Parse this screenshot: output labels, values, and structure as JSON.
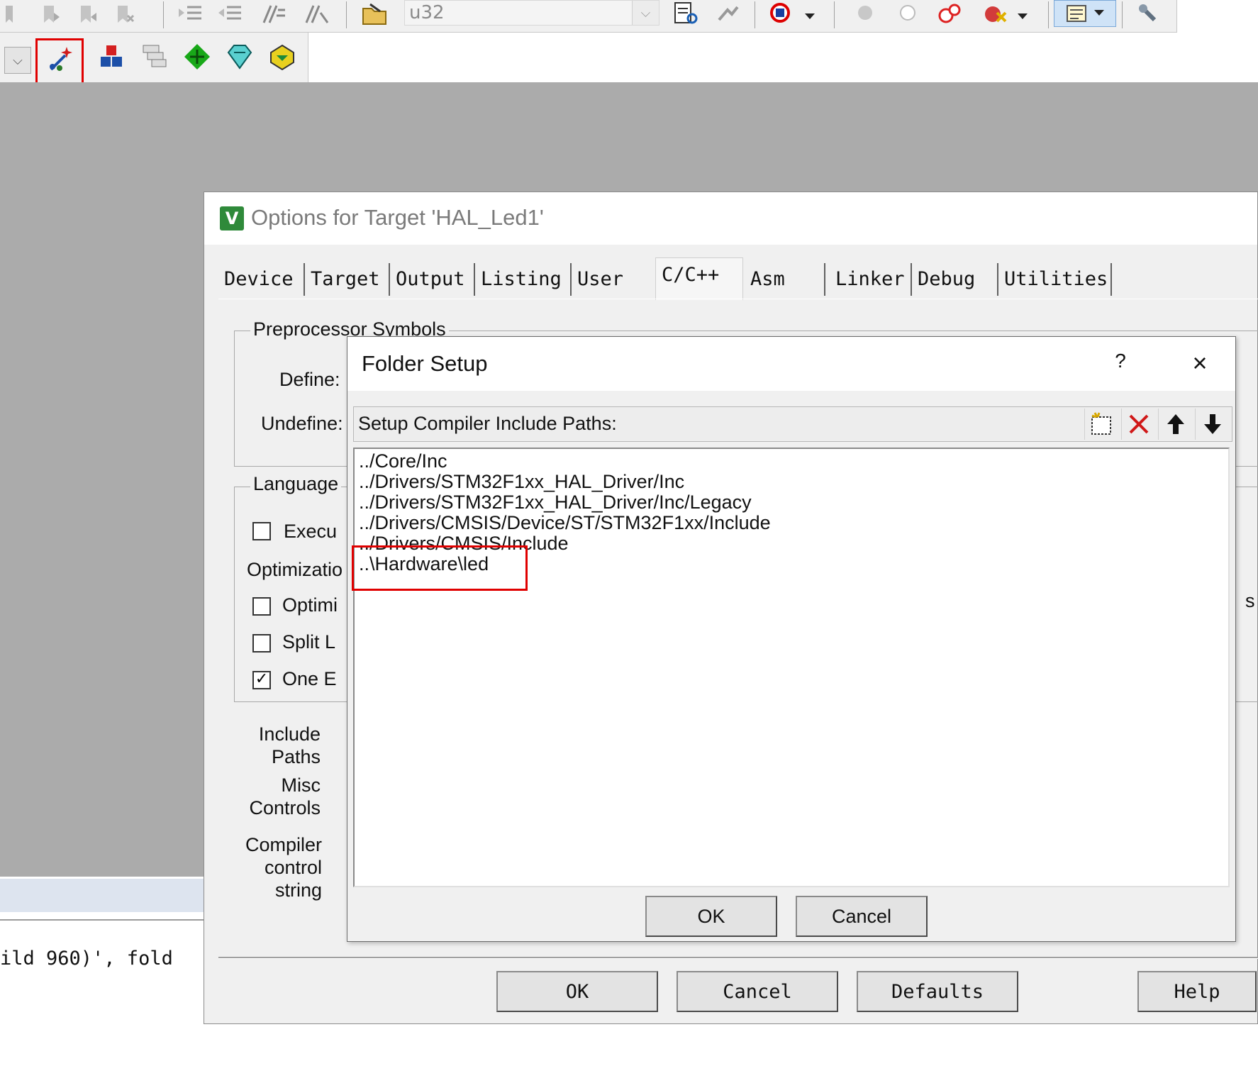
{
  "toolbar": {
    "target_combo_value": "u32",
    "icons": [
      "indent-icon",
      "unindent-icon",
      "comment-icon",
      "uncomment-icon",
      "open-folder-icon",
      "find-in-files-icon",
      "debug-icon",
      "breakpoint-icon",
      "disable-breakpoint-icon",
      "kill-breakpoints-icon",
      "window-layout-icon",
      "tools-icon",
      "options-for-target-icon",
      "manage-project-items-icon",
      "select-packs-icon",
      "manage-run-time-environment-icon",
      "pack-installer-icon"
    ]
  },
  "output": {
    "text": "ild 960)', fold"
  },
  "options_dialog": {
    "title": "Options for Target 'HAL_Led1'",
    "tabs": [
      "Device",
      "Target",
      "Output",
      "Listing",
      "User",
      "C/C++",
      "Asm",
      "Linker",
      "Debug",
      "Utilities"
    ],
    "active_tab": "C/C++",
    "preprocessor_group": "Preprocessor Symbols",
    "define_label": "Define:",
    "undefine_label": "Undefine:",
    "language_group": "Language",
    "execute_label": "Execu",
    "optimization_label": "Optimizatio",
    "options": [
      {
        "label": "Optimi",
        "checked": false
      },
      {
        "label": "Split L",
        "checked": false
      },
      {
        "label": "One E",
        "checked": true
      }
    ],
    "include_paths_label": [
      "Include",
      "Paths"
    ],
    "misc_controls_label": [
      "Misc",
      "Controls"
    ],
    "compiler_control_label": [
      "Compiler",
      "control",
      "string"
    ],
    "buttons": {
      "ok": "OK",
      "cancel": "Cancel",
      "defaults": "Defaults",
      "help": "Help"
    },
    "right_edge_s": "s"
  },
  "folder_dialog": {
    "title": "Folder Setup",
    "help": "?",
    "close": "×",
    "header_label": "Setup Compiler Include Paths:",
    "paths": [
      "../Core/Inc",
      "../Drivers/STM32F1xx_HAL_Driver/Inc",
      "../Drivers/STM32F1xx_HAL_Driver/Inc/Legacy",
      "../Drivers/CMSIS/Device/ST/STM32F1xx/Include",
      "../Drivers/CMSIS/Include",
      "..\\Hardware\\led"
    ],
    "buttons": {
      "ok": "OK",
      "cancel": "Cancel"
    }
  },
  "colors": {
    "highlight_red": "#e00000",
    "workspace_gray": "#ababab"
  }
}
